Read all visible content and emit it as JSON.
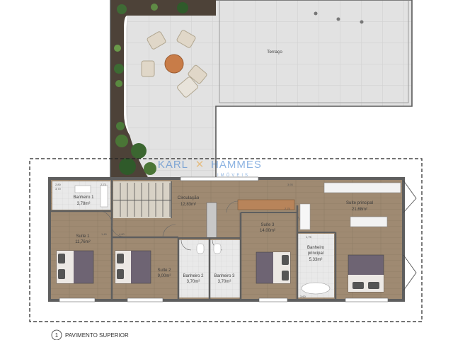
{
  "watermark": {
    "left": "KARL",
    "right": "HAMMES",
    "sub": "IMÓVEIS",
    "color": "#2e74c9"
  },
  "title": {
    "number": "1",
    "text": "PAVIMENTO SUPERIOR"
  },
  "rooms": {
    "terraco": {
      "name": "Terraço"
    },
    "circulacao": {
      "name": "Circulação",
      "area": "12,83m²"
    },
    "banheiro1": {
      "name": "Banheiro 1",
      "area": "3,78m²"
    },
    "suite1": {
      "name": "Suíte 1",
      "area": "11,76m²"
    },
    "suite2": {
      "name": "Suíte 2",
      "area": "9,00m²"
    },
    "banheiro2": {
      "name": "Banheiro 2",
      "area": "3,70m²"
    },
    "banheiro3": {
      "name": "Banheiro 3",
      "area": "3,70m²"
    },
    "suite3": {
      "name": "Suíte 3",
      "area": "14,00m²"
    },
    "banheiro_principal": {
      "name1": "Banheiro",
      "name2": "principal",
      "area": "5,33m²"
    },
    "suite_principal": {
      "name": "Suíte principal",
      "area": "21,68m²"
    }
  },
  "dimensions": [
    "2,80",
    "2,73",
    "3,93",
    "3,70",
    "1,40",
    "4,60",
    "2,75",
    "1,75",
    "3,60"
  ],
  "colors": {
    "wood": "#a08a70",
    "wall": "#6a6a6a",
    "tile": "#e4e4e4",
    "grass": "#4d4238",
    "accent": "#2e74c9"
  }
}
